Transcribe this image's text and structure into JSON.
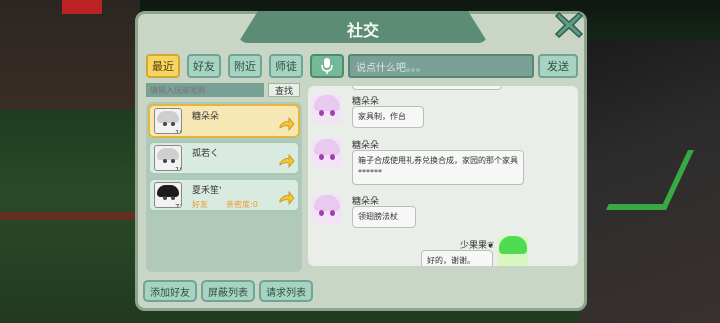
{
  "panel": {
    "title": "社交"
  },
  "tabs": [
    {
      "label": "最近",
      "active": true
    },
    {
      "label": "好友",
      "active": false
    },
    {
      "label": "附近",
      "active": false
    },
    {
      "label": "师徒",
      "active": false
    }
  ],
  "search": {
    "placeholder": "请输入玩家昵称",
    "button": "查找"
  },
  "friends": [
    {
      "name": "糖朵朵",
      "level": "101",
      "selected": true
    },
    {
      "name": "孤若く",
      "level": "100",
      "selected": false
    },
    {
      "name": "夏禾笙'",
      "level": "71",
      "selected": false,
      "tag": "好友",
      "intimacy": "亲密度:0"
    }
  ],
  "bottom_buttons": [
    "添加好友",
    "屏蔽列表",
    "请求列表"
  ],
  "chat": {
    "input_placeholder": "说点什么吧。。。",
    "send": "发送",
    "messages": [
      {
        "sender": "糖朵朵",
        "text": "家具制，作台"
      },
      {
        "sender": "糖朵朵",
        "text": "箱子合成使用礼券兑换合成，家园的那个家具******"
      },
      {
        "sender": "糖朵朵",
        "text": "领翅膀法杖"
      }
    ],
    "self": {
      "sender": "少果果❦",
      "text": "好的，谢谢。"
    }
  },
  "icons": {
    "close": "close-icon",
    "mic": "microphone-icon",
    "arrow": "arrow-right-icon"
  },
  "colors": {
    "title_bar": "#5d8c76",
    "active_tab": "#f4d662",
    "panel_bg": "#c9d6c6",
    "accent_orange": "#e79a2a"
  }
}
